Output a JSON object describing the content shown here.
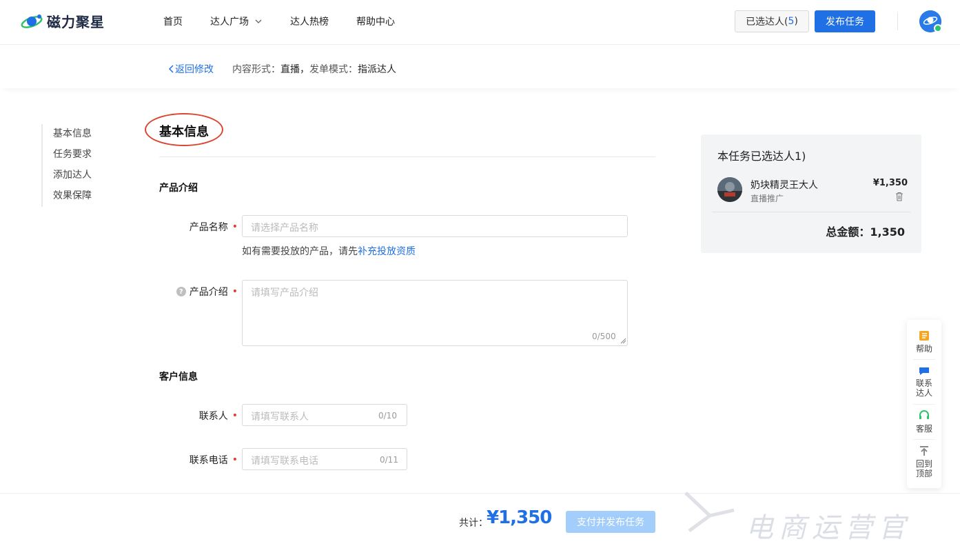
{
  "header": {
    "logo_text": "磁力聚星",
    "nav": [
      {
        "label": "首页"
      },
      {
        "label": "达人广场"
      },
      {
        "label": "达人热榜"
      },
      {
        "label": "帮助中心"
      }
    ],
    "selected_label": "已选达人(",
    "selected_count": "5",
    "selected_close": ")",
    "publish_label": "发布任务"
  },
  "subbar": {
    "back_label": "返回修改",
    "content_form_label": "内容形式：",
    "content_form_value": "直播",
    "sep": "，",
    "dispatch_label": "发单模式：",
    "dispatch_value": "指派达人"
  },
  "side_menu": [
    "基本信息",
    "任务要求",
    "添加达人",
    "效果保障"
  ],
  "form": {
    "section_title": "基本信息",
    "product_group": "产品介绍",
    "product_name_label": "产品名称",
    "product_name_placeholder": "请选择产品名称",
    "hint_prefix": "如有需要投放的产品，请先",
    "hint_link": "补充投放资质",
    "product_intro_label": "产品介绍",
    "product_intro_placeholder": "请填写产品介绍",
    "product_intro_counter": "0/500",
    "customer_group": "客户信息",
    "contact_label": "联系人",
    "contact_placeholder": "请填写联系人",
    "contact_counter": "0/10",
    "phone_label": "联系电话",
    "phone_placeholder": "请填写联系电话",
    "phone_counter": "0/11"
  },
  "card": {
    "title": "本任务已选达人1)",
    "creator_name": "奶块精灵王大人",
    "creator_type": "直播推广",
    "creator_price": "¥1,350",
    "total": "总金额：1,350"
  },
  "float_bar": {
    "help": "帮助",
    "contact_1": "联系",
    "contact_2": "达人",
    "service": "客服",
    "top_1": "回到",
    "top_2": "顶部"
  },
  "bottom": {
    "total_label": "共计：",
    "total_amount": "¥1,350",
    "pay_label": "支付并发布任务"
  },
  "watermark": {
    "text": "电商运营官"
  },
  "colors": {
    "brand": "#1f6fe5",
    "required": "#e53c2a",
    "highlight_ring": "#d9462f",
    "disabled_button": "#a3cdfa"
  }
}
